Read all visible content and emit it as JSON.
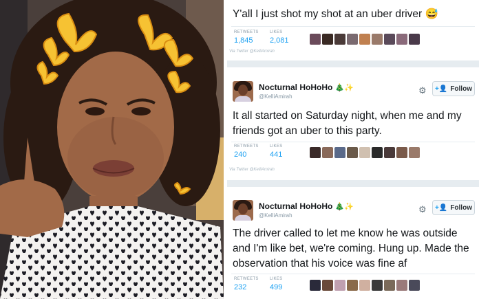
{
  "tweet1": {
    "text": "Y'all I just shot my shot at an uber driver 😅",
    "retweets_label": "RETWEETS",
    "retweets": "1,845",
    "likes_label": "LIKES",
    "likes": "2,081",
    "via": "Via Twitter @KelliAmirah"
  },
  "tweet2": {
    "display_name": "Nocturnal HoHoHo",
    "handle": "@KelliAmirah",
    "follow_label": "Follow",
    "text": "It all started on Saturday night, when me and my friends got an uber to this party.",
    "retweets_label": "RETWEETS",
    "retweets": "240",
    "likes_label": "LIKES",
    "likes": "441",
    "via": "Via Twitter @KelliAmirah"
  },
  "tweet3": {
    "display_name": "Nocturnal HoHoHo",
    "handle": "@KelliAmirah",
    "follow_label": "Follow",
    "text": "The driver called to let me know he was outside and I'm like bet, we're coming. Hung up. Made the observation that his voice was fine af",
    "retweets_label": "RETWEETS",
    "retweets": "232",
    "likes_label": "LIKES",
    "likes": "499"
  },
  "icons": {
    "tree": "🎄",
    "sparkle": "✨",
    "gear": "⚙",
    "follow": "+👤"
  },
  "colors": {
    "link_blue": "#1da1f2",
    "separator": "#e6ecf0",
    "text": "#14171a",
    "muted": "#8899a6"
  }
}
